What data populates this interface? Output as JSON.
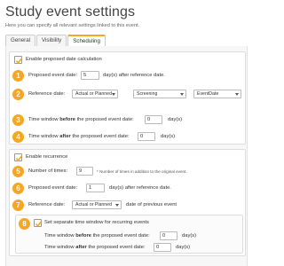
{
  "header": {
    "title": "Study event settings",
    "subtitle": "Here you can specify all relevant settings linked to this event."
  },
  "tabs": [
    {
      "label": "General",
      "active": false
    },
    {
      "label": "Visibility",
      "active": false
    },
    {
      "label": "Scheduling",
      "active": true
    }
  ],
  "colors": {
    "accent": "#f5a623",
    "check": "#f5a623"
  },
  "section1": {
    "checkbox_label": "Enable proposed date calculation",
    "checked": true,
    "rows": {
      "r1": {
        "badge": "1",
        "label": "Proposed event date:",
        "value": "5",
        "suffix": "day(s) after reference date."
      },
      "r2": {
        "badge": "2",
        "label": "Reference date:",
        "select1": "Actual or Planned",
        "select2": "Screening",
        "select3": "EventDate"
      },
      "r3": {
        "badge": "3",
        "label_pre": "Time window ",
        "label_bold": "before",
        "label_post": " the proposed event date:",
        "value": "0",
        "suffix": "day(s)"
      },
      "r4": {
        "badge": "4",
        "label_pre": "Time window ",
        "label_bold": "after",
        "label_post": " the proposed event date:",
        "value": "0",
        "suffix": "day(s)"
      }
    }
  },
  "section2": {
    "checkbox_label": "Enable recurrence",
    "checked": true,
    "rows": {
      "r5": {
        "badge": "5",
        "label": "Number of times:",
        "value": "9",
        "hint": "Number of times in addition to the original event."
      },
      "r6": {
        "badge": "6",
        "label": "Proposed event date:",
        "value": "1",
        "suffix": "day(s) after reference date."
      },
      "r7": {
        "badge": "7",
        "label": "Reference date:",
        "select1": "Actual or Planned",
        "suffix": "date of previous event"
      }
    }
  },
  "section3": {
    "badge": "8",
    "checkbox_label": "Set separate time window for recurring events",
    "checked": true,
    "before": {
      "label_pre": "Time window ",
      "label_bold": "before",
      "label_post": " the proposed event date:",
      "value": "0",
      "suffix": "day(s)"
    },
    "after": {
      "label_pre": "Time window ",
      "label_bold": "after",
      "label_post": " the proposed event date:",
      "value": "0",
      "suffix": "day(s)"
    }
  }
}
